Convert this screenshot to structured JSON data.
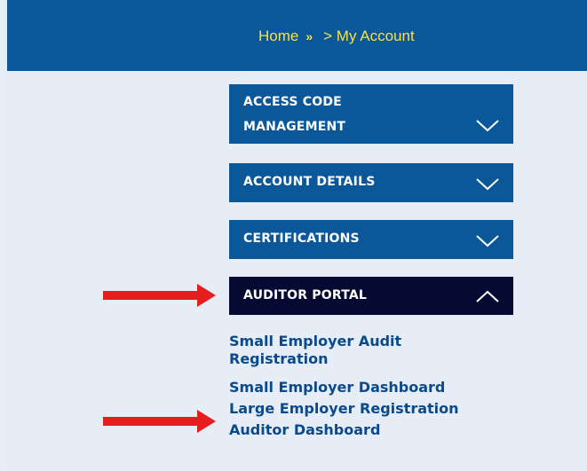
{
  "breadcrumb": {
    "home": "Home",
    "separator": "»",
    "current": "> My Account"
  },
  "accordion": [
    {
      "label_line1": "ACCESS CODE",
      "label_line2": "MANAGEMENT",
      "state": "collapsed",
      "chevron": "chevron-down-icon"
    },
    {
      "label": "ACCOUNT DETAILS",
      "state": "collapsed",
      "chevron": "chevron-down-icon"
    },
    {
      "label": "CERTIFICATIONS",
      "state": "collapsed",
      "chevron": "chevron-down-icon"
    },
    {
      "label": "AUDITOR PORTAL",
      "state": "expanded",
      "chevron": "chevron-up-icon"
    }
  ],
  "auditor_links": [
    {
      "label_line1": "Small Employer Audit",
      "label_line2": "Registration"
    },
    {
      "label": "Small Employer Dashboard"
    },
    {
      "label": "Large Employer Registration"
    },
    {
      "label": "Auditor Dashboard"
    }
  ],
  "annotation_arrows": [
    "red-arrow-icon",
    "red-arrow-icon"
  ],
  "colors": {
    "header_bg": "#0a5799",
    "breadcrumb_text": "#f3e24a",
    "panel_bg": "#0a5799",
    "active_panel_bg": "#050a33",
    "link_text": "#0a4a8c",
    "arrow": "#e41e1e"
  }
}
